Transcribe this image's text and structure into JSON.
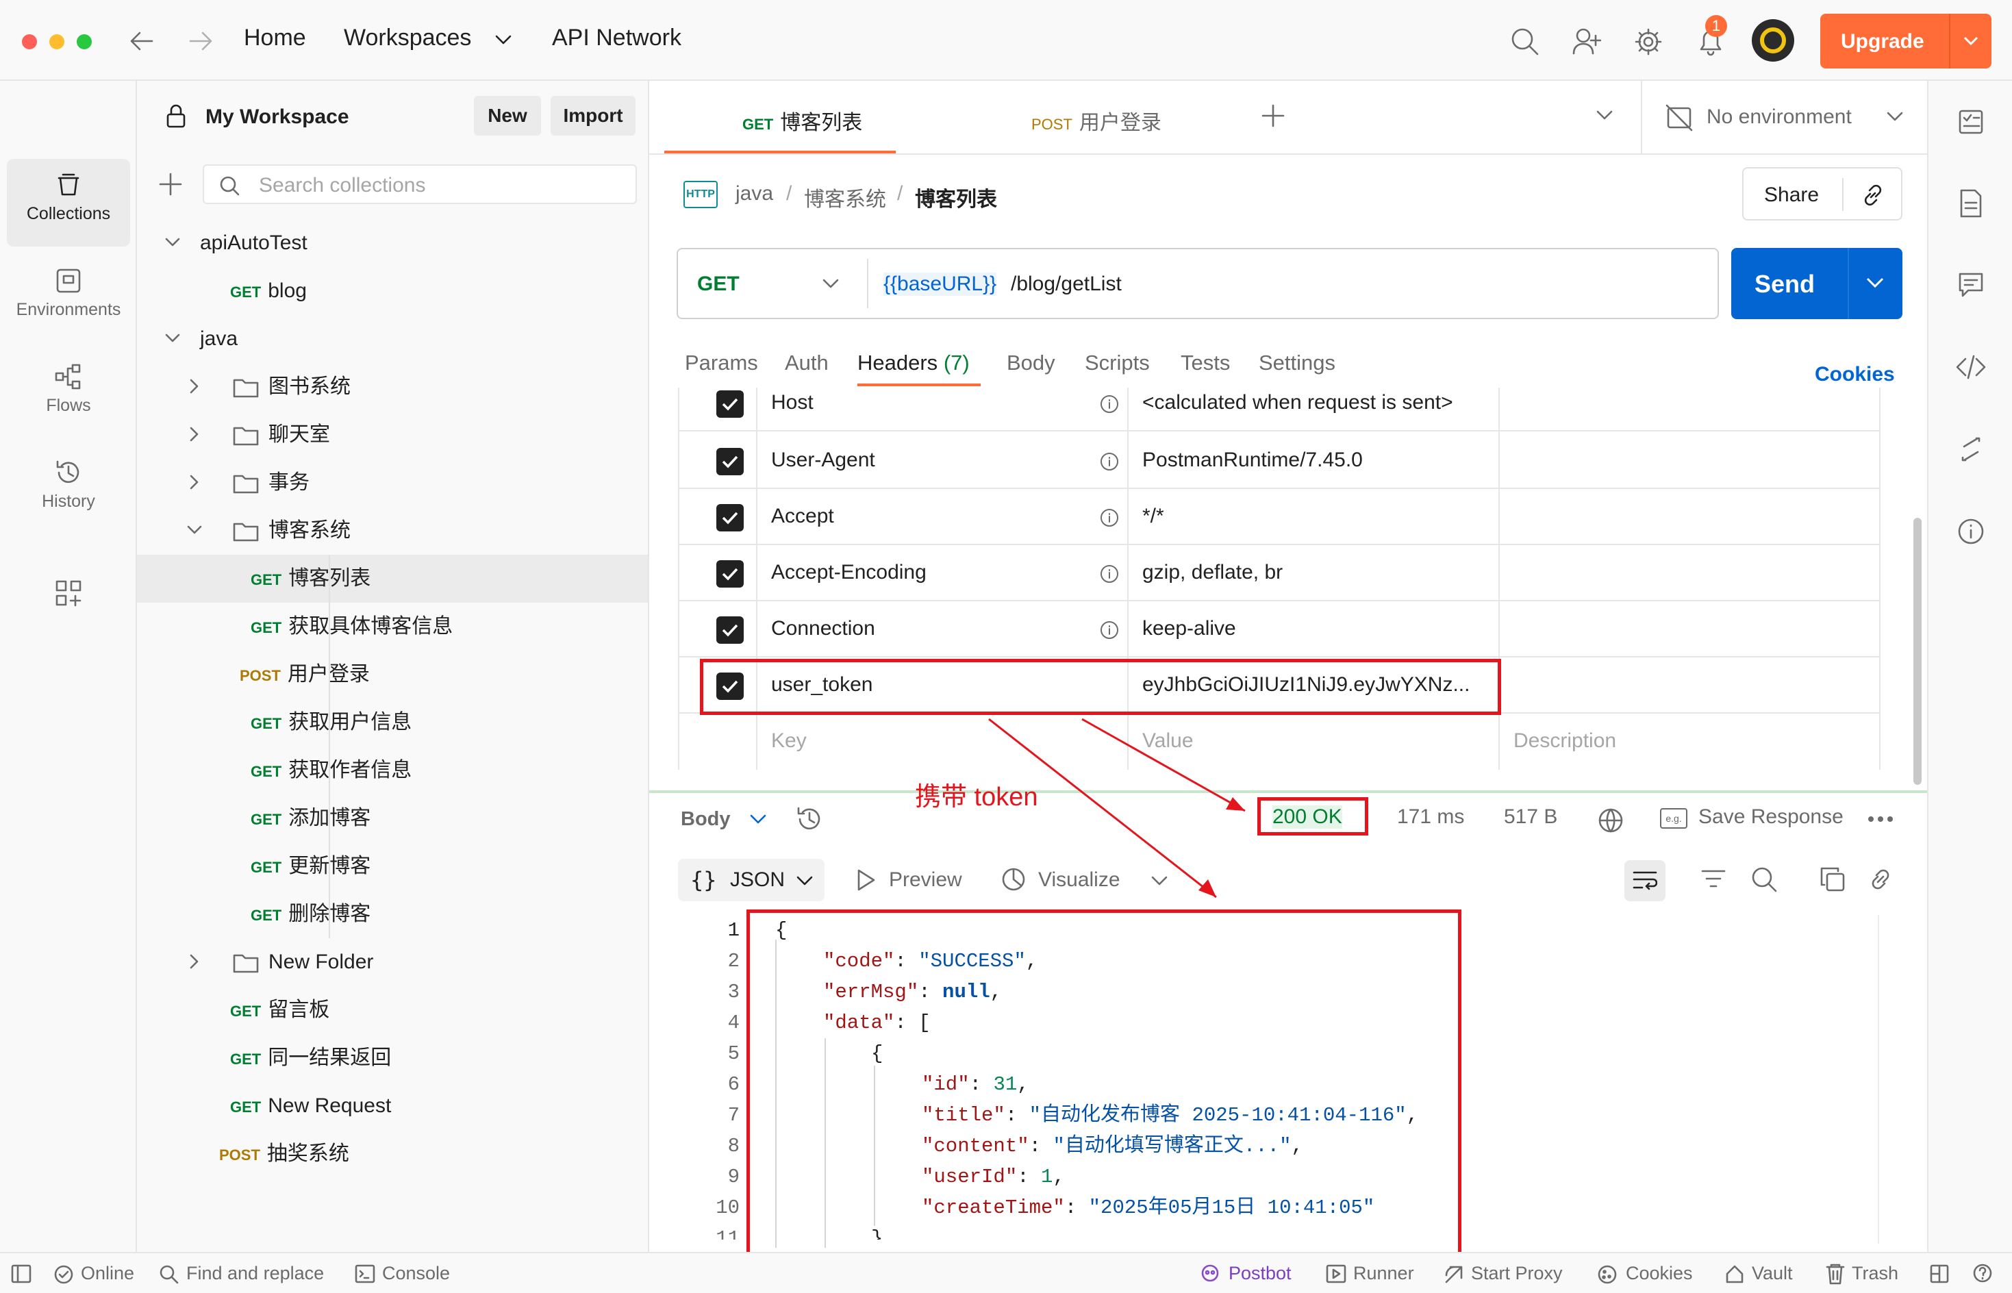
{
  "topbar": {
    "home": "Home",
    "workspaces": "Workspaces",
    "api_network": "API Network",
    "notification_count": "1",
    "upgrade": "Upgrade"
  },
  "leftrail": {
    "items": [
      {
        "label": "Collections",
        "icon": "collections-icon"
      },
      {
        "label": "Environments",
        "icon": "environments-icon"
      },
      {
        "label": "Flows",
        "icon": "flows-icon"
      },
      {
        "label": "History",
        "icon": "history-icon"
      }
    ]
  },
  "sidebar": {
    "workspace": "My Workspace",
    "new": "New",
    "import": "Import",
    "search_placeholder": "Search collections",
    "tree": [
      {
        "label": "apiAutoTest",
        "type": "collection",
        "expanded": true
      },
      {
        "method": "GET",
        "label": "blog"
      },
      {
        "label": "java",
        "type": "collection",
        "expanded": true
      },
      {
        "label": "图书系统",
        "type": "folder"
      },
      {
        "label": "聊天室",
        "type": "folder"
      },
      {
        "label": "事务",
        "type": "folder"
      },
      {
        "label": "博客系统",
        "type": "folder",
        "expanded": true
      },
      {
        "method": "GET",
        "label": "博客列表",
        "selected": true
      },
      {
        "method": "GET",
        "label": "获取具体博客信息"
      },
      {
        "method": "POST",
        "label": "用户登录"
      },
      {
        "method": "GET",
        "label": "获取用户信息"
      },
      {
        "method": "GET",
        "label": "获取作者信息"
      },
      {
        "method": "GET",
        "label": "添加博客"
      },
      {
        "method": "GET",
        "label": "更新博客"
      },
      {
        "method": "GET",
        "label": "删除博客"
      },
      {
        "label": "New Folder",
        "type": "folder"
      },
      {
        "method": "GET",
        "label": "留言板"
      },
      {
        "method": "GET",
        "label": "同一结果返回"
      },
      {
        "method": "GET",
        "label": "New Request"
      },
      {
        "method": "POST",
        "label": "抽奖系统"
      }
    ]
  },
  "tabs": [
    {
      "method": "GET",
      "label": "博客列表",
      "active": true
    },
    {
      "method": "POST",
      "label": "用户登录"
    }
  ],
  "environment": "No environment",
  "breadcrumb": {
    "collection": "java",
    "folder": "博客系统",
    "request": "博客列表",
    "share": "Share"
  },
  "request": {
    "method": "GET",
    "url_var": "{{baseURL}}",
    "url_path": "/blog/getList",
    "send": "Send"
  },
  "req_tabs": {
    "params": "Params",
    "auth": "Auth",
    "headers": "Headers",
    "headers_count": "(7)",
    "body": "Body",
    "scripts": "Scripts",
    "tests": "Tests",
    "settings": "Settings",
    "cookies": "Cookies"
  },
  "headers": [
    {
      "key": "Host",
      "value": "<calculated when request is sent>"
    },
    {
      "key": "User-Agent",
      "value": "PostmanRuntime/7.45.0"
    },
    {
      "key": "Accept",
      "value": "*/*"
    },
    {
      "key": "Accept-Encoding",
      "value": "gzip, deflate, br"
    },
    {
      "key": "Connection",
      "value": "keep-alive"
    },
    {
      "key": "user_token",
      "value": "eyJhbGciOiJIUzI1NiJ9.eyJwYXNz..."
    }
  ],
  "headers_placeholder": {
    "key": "Key",
    "value": "Value",
    "description": "Description"
  },
  "annotation": "携带 token",
  "response": {
    "body": "Body",
    "status": "200 OK",
    "time": "171 ms",
    "size": "517 B",
    "save": "Save Response",
    "format": "JSON",
    "preview": "Preview",
    "visualize": "Visualize",
    "line_numbers": [
      "1",
      "2",
      "3",
      "4",
      "5",
      "6",
      "7",
      "8",
      "9",
      "10",
      "11"
    ],
    "json": {
      "code_key": "\"code\"",
      "code_val": "\"SUCCESS\"",
      "errmsg_key": "\"errMsg\"",
      "errmsg_val": "null",
      "data_key": "\"data\"",
      "id_key": "\"id\"",
      "id_val": "31",
      "title_key": "\"title\"",
      "title_val": "\"自动化发布博客 2025-10:41:04-116\"",
      "content_key": "\"content\"",
      "content_val": "\"自动化填写博客正文...\"",
      "userid_key": "\"userId\"",
      "userid_val": "1",
      "createtime_key": "\"createTime\"",
      "createtime_val": "\"2025年05月15日 10:41:05\""
    }
  },
  "statusbar": {
    "online": "Online",
    "find": "Find and replace",
    "console": "Console",
    "postbot": "Postbot",
    "runner": "Runner",
    "proxy": "Start Proxy",
    "cookies": "Cookies",
    "vault": "Vault",
    "trash": "Trash"
  },
  "colors": {
    "accent": "#ff6c37",
    "send": "#0265d2",
    "get": "#007f31",
    "post": "#ad7a03",
    "annotation": "#e5151d"
  }
}
